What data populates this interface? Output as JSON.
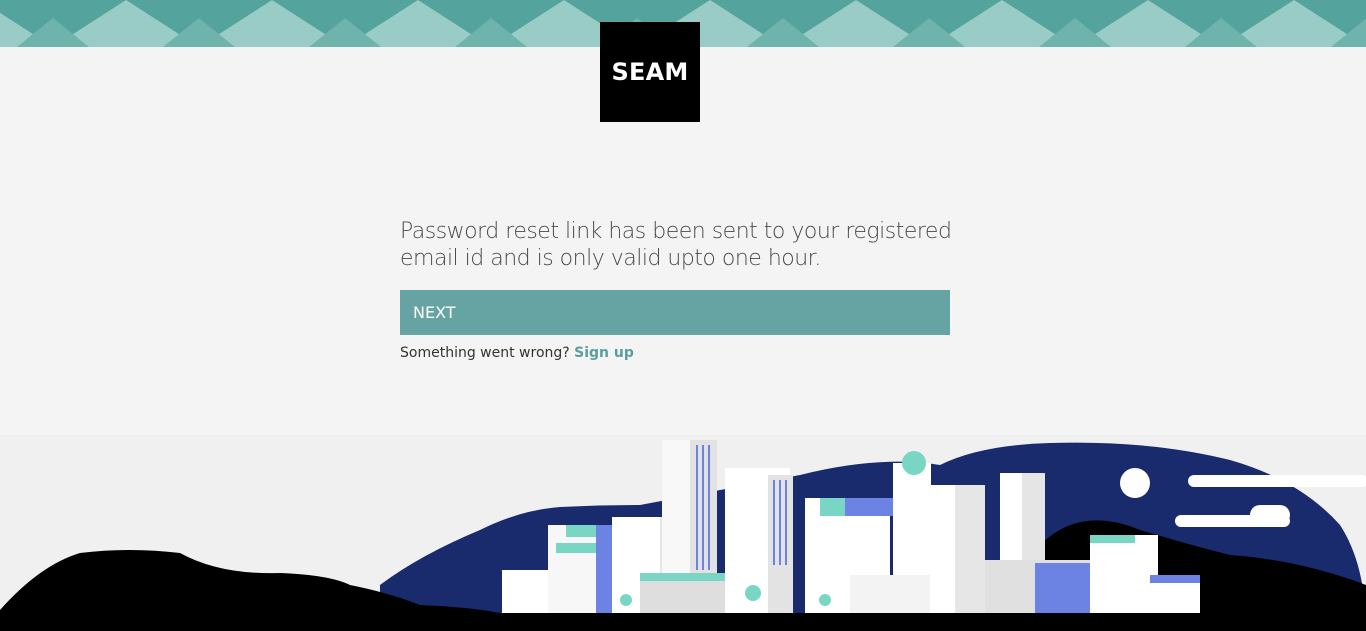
{
  "logo": {
    "text": "SEAM"
  },
  "message": "Password reset link has been sent to your registered email id and is only valid upto one hour.",
  "next_button": {
    "label": "NEXT"
  },
  "help": {
    "prefix": "Something went wrong?",
    "link_label": "Sign up"
  },
  "colors": {
    "accent": "#66a3a3",
    "band_light": "#99ccc7",
    "band_dark": "#55a39d",
    "navy": "#1a2b6d",
    "link": "#5a9e9e"
  }
}
